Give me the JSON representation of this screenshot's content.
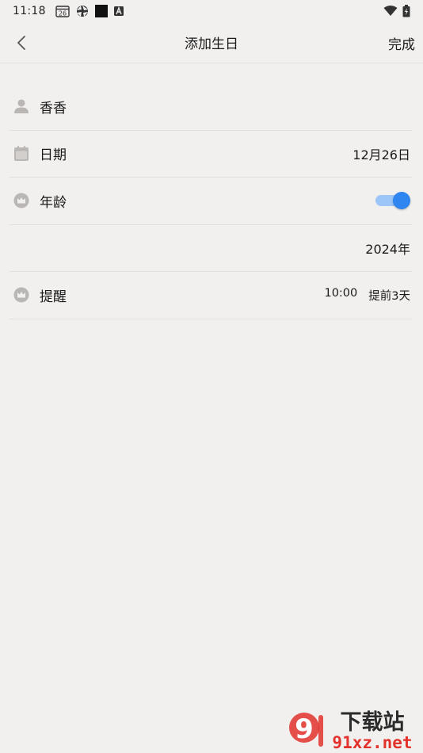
{
  "status_bar": {
    "time": "11:18",
    "calendar_day": "26",
    "icons": [
      "calendar-icon",
      "aperture-icon",
      "black-square-icon",
      "a-badge-icon",
      "wifi-icon",
      "battery-icon"
    ]
  },
  "header": {
    "title": "添加生日",
    "done_label": "完成"
  },
  "form": {
    "name": {
      "value": "香香",
      "icon": "person-icon"
    },
    "date": {
      "label": "日期",
      "value": "12月26日",
      "icon": "calendar-icon"
    },
    "age": {
      "label": "年龄",
      "toggle_on": true,
      "icon": "crown-icon"
    },
    "year": {
      "value": "2024年"
    },
    "reminder": {
      "label": "提醒",
      "time": "10:00",
      "advance": "提前3天",
      "icon": "crown-icon"
    }
  },
  "watermark": {
    "text_top": "下载站",
    "text_bottom": "91xz.net",
    "logo_text": "9"
  },
  "colors": {
    "background": "#f2f0ef",
    "toggle_track": "#9cc6f7",
    "toggle_knob": "#2f86f0",
    "icon_gray": "#b9b6b4",
    "watermark_red": "#e2322b"
  }
}
